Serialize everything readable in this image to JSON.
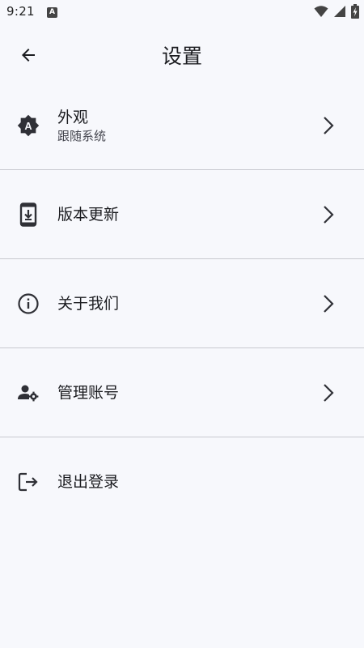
{
  "status_bar": {
    "time": "9:21",
    "notification_icon": "a-letter-icon",
    "notification_letter": "A",
    "icons": [
      "wifi-icon",
      "signal-icon",
      "battery-charging-icon"
    ]
  },
  "header": {
    "back_icon": "arrow-left-icon",
    "title": "设置"
  },
  "settings": {
    "items": [
      {
        "icon": "brightness-auto-icon",
        "label": "外观",
        "subtitle": "跟随系统",
        "chevron": "chevron-right-icon"
      },
      {
        "icon": "phone-download-icon",
        "label": "版本更新",
        "chevron": "chevron-right-icon"
      },
      {
        "icon": "info-icon",
        "label": "关于我们",
        "chevron": "chevron-right-icon"
      },
      {
        "icon": "manage-account-icon",
        "label": "管理账号",
        "chevron": "chevron-right-icon"
      },
      {
        "icon": "logout-icon",
        "label": "退出登录"
      }
    ]
  },
  "colors": {
    "background": "#f7f8fc",
    "divider": "#c8c9cf",
    "text_primary": "#1b1c20",
    "text_secondary": "#45464f"
  }
}
